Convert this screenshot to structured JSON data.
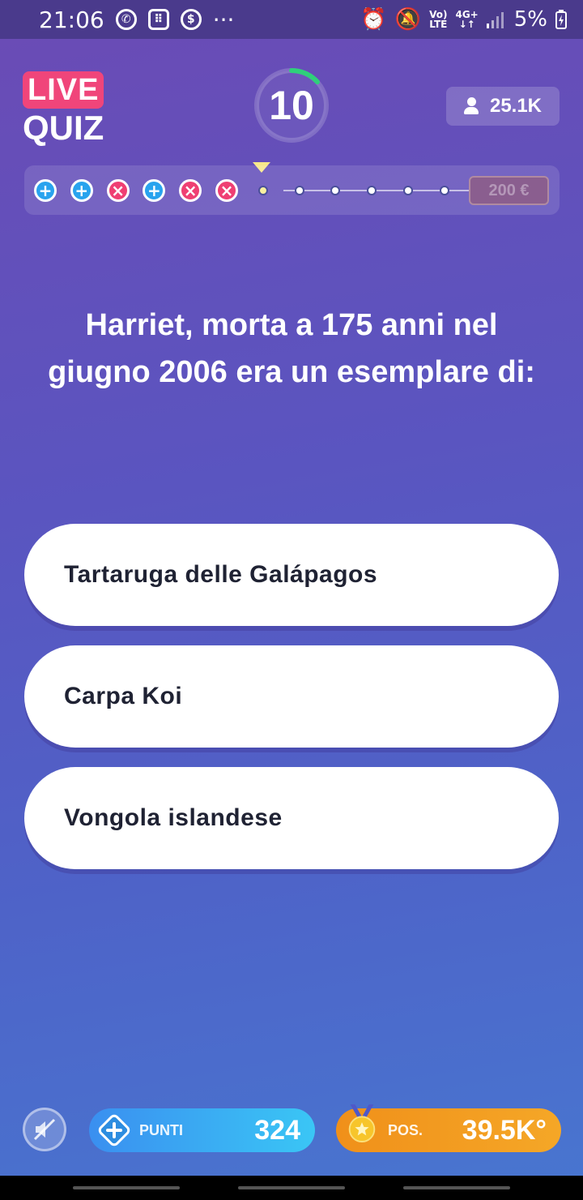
{
  "status_bar": {
    "time": "21:06",
    "more": "···",
    "network_top": "Vo)",
    "network_bottom": "LTE",
    "signal_top": "4G+",
    "signal_bottom": "↓↑",
    "battery": "5%"
  },
  "header": {
    "logo_live": "LIVE",
    "logo_quiz": "QUIZ",
    "timer": "10",
    "viewers": "25.1K"
  },
  "progress": {
    "results": [
      "correct",
      "correct",
      "wrong",
      "correct",
      "wrong",
      "wrong"
    ],
    "current_index": 6,
    "total_questions": 12,
    "prize": "200 €"
  },
  "question": {
    "text": "Harriet, morta a 175 anni nel giugno 2006 era un esemplare di:"
  },
  "answers": [
    {
      "label": "Tartaruga delle Galápagos"
    },
    {
      "label": "Carpa Koi"
    },
    {
      "label": "Vongola islandese"
    }
  ],
  "bottom": {
    "points_label": "PUNTI",
    "points_value": "324",
    "position_label": "POS.",
    "position_value": "39.5K°"
  },
  "colors": {
    "correct": "#29a3ee",
    "wrong": "#ef3f73",
    "timer_arc": "#2fd07a",
    "points_pill": "#3aa8f2",
    "position_pill": "#f29a20"
  }
}
